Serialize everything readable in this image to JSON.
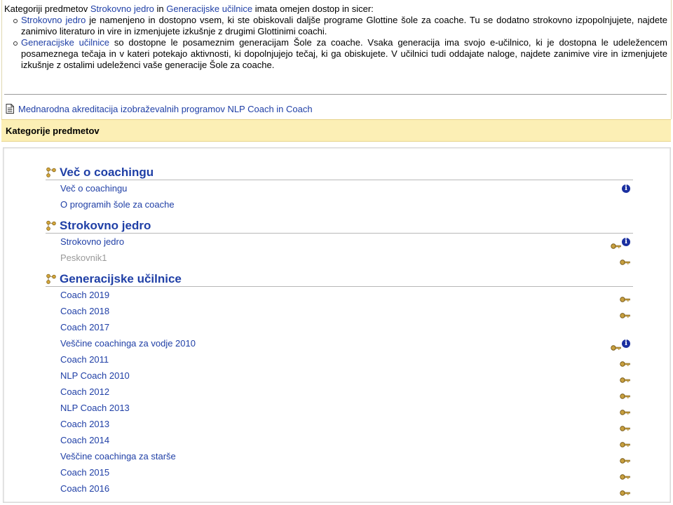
{
  "intro": {
    "lead_before": "Kategoriji predmetov ",
    "lead_link1": "Strokovno jedro",
    "lead_mid": " in ",
    "lead_link2": "Generacijske učilnice",
    "lead_after": " imata omejen dostop in sicer:",
    "items": [
      {
        "link": "Strokovno jedro",
        "text": " je namenjeno in dostopno vsem, ki ste obiskovali daljše programe Glottine šole za coache. Tu se dodatno strokovno izpopolnjujete, najdete zanimivo literaturo in vire in izmenjujete izkušnje z drugimi Glottinimi coachi."
      },
      {
        "link": "Generacijske učilnice",
        "text": " so dostopne le posameznim generacijam Šole za coache. Vsaka generacija ima svojo e-učilnico, ki je dostopna le udeležencem posameznega tečaja in v kateri potekajo aktivnosti, ki dopolnjujejo tečaj, ki ga obiskujete. V učilnici tudi oddajate naloge, najdete zanimive vire in izmenjujete izkušnje z ostalimi udeleženci vaše generacije Šole za coache."
      }
    ]
  },
  "accreditation_link": "Mednarodna akreditacija izobraževalnih programov NLP Coach in Coach",
  "band_title": "Kategorije predmetov",
  "info_glyph": "i",
  "colors": {
    "link": "#1f3fa6",
    "band": "#fcefb5",
    "info": "#1a2fa0",
    "key": "#c8a040"
  },
  "categories": [
    {
      "title": "Več o coachingu",
      "courses": [
        {
          "name": "Več o coachingu",
          "dimmed": false,
          "key": false,
          "info": true
        },
        {
          "name": "O programih šole za coache",
          "dimmed": false,
          "key": false,
          "info": false
        }
      ]
    },
    {
      "title": "Strokovno jedro",
      "courses": [
        {
          "name": "Strokovno jedro",
          "dimmed": false,
          "key": true,
          "info": true
        },
        {
          "name": "Peskovnik1",
          "dimmed": true,
          "key": true,
          "info": false
        }
      ]
    },
    {
      "title": "Generacijske učilnice",
      "courses": [
        {
          "name": "Coach 2019",
          "dimmed": false,
          "key": true,
          "info": false
        },
        {
          "name": "Coach 2018",
          "dimmed": false,
          "key": true,
          "info": false
        },
        {
          "name": "Coach 2017",
          "dimmed": false,
          "key": false,
          "info": false
        },
        {
          "name": "Veščine coachinga za vodje 2010",
          "dimmed": false,
          "key": true,
          "info": true
        },
        {
          "name": "Coach 2011",
          "dimmed": false,
          "key": true,
          "info": false
        },
        {
          "name": "NLP Coach 2010",
          "dimmed": false,
          "key": true,
          "info": false
        },
        {
          "name": "Coach 2012",
          "dimmed": false,
          "key": true,
          "info": false
        },
        {
          "name": "NLP Coach 2013",
          "dimmed": false,
          "key": true,
          "info": false
        },
        {
          "name": "Coach 2013",
          "dimmed": false,
          "key": true,
          "info": false
        },
        {
          "name": "Coach 2014",
          "dimmed": false,
          "key": true,
          "info": false
        },
        {
          "name": "Veščine coachinga za starše",
          "dimmed": false,
          "key": true,
          "info": false
        },
        {
          "name": "Coach 2015",
          "dimmed": false,
          "key": true,
          "info": false
        },
        {
          "name": "Coach 2016",
          "dimmed": false,
          "key": true,
          "info": false
        }
      ]
    }
  ]
}
